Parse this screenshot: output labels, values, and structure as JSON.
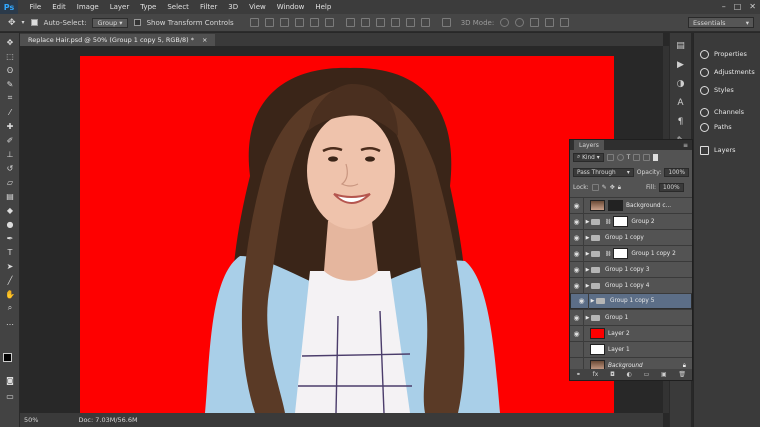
{
  "app": {
    "logo": "Ps"
  },
  "menu": [
    "File",
    "Edit",
    "Image",
    "Layer",
    "Type",
    "Select",
    "Filter",
    "3D",
    "View",
    "Window",
    "Help"
  ],
  "window_controls": [
    "–",
    "□",
    "✕"
  ],
  "options": {
    "auto_select_label": "Auto-Select:",
    "auto_select_value": "Group",
    "show_transform_label": "Show Transform Controls",
    "mode_3d_label": "3D Mode:",
    "workspace": "Essentials"
  },
  "document_tab": {
    "title": "Replace Hair.psd @ 50% (Group 1 copy 5, RGB/8) *",
    "close": "×"
  },
  "status": {
    "zoom": "50%",
    "doc": "Doc: 7.03M/56.6M"
  },
  "right_panel": [
    {
      "label": "Properties",
      "icon": "properties-icon"
    },
    {
      "label": "Adjustments",
      "icon": "adjustments-icon"
    },
    {
      "label": "Styles",
      "icon": "styles-icon"
    },
    {
      "label": "Channels",
      "icon": "channels-icon"
    },
    {
      "label": "Paths",
      "icon": "paths-icon"
    },
    {
      "label": "Layers",
      "icon": "layers-icon"
    }
  ],
  "layers_panel": {
    "tab": "Layers",
    "kind_label": "Kind",
    "blend_mode": "Pass Through",
    "opacity_label": "Opacity:",
    "opacity_value": "100%",
    "lock_label": "Lock:",
    "fill_label": "Fill:",
    "fill_value": "100%",
    "layers": [
      {
        "name": "Background c...",
        "type": "image",
        "visible": true,
        "selected": false,
        "mask": true
      },
      {
        "name": "Group 2",
        "type": "group",
        "visible": true,
        "selected": false,
        "mask": true
      },
      {
        "name": "Group 1 copy",
        "type": "group",
        "visible": true,
        "selected": false,
        "mask": false
      },
      {
        "name": "Group 1 copy 2",
        "type": "group",
        "visible": true,
        "selected": false,
        "mask": true
      },
      {
        "name": "Group 1 copy 3",
        "type": "group",
        "visible": true,
        "selected": false,
        "mask": false
      },
      {
        "name": "Group 1 copy 4",
        "type": "group",
        "visible": true,
        "selected": false,
        "mask": false
      },
      {
        "name": "Group 1 copy 5",
        "type": "group",
        "visible": true,
        "selected": true,
        "mask": false
      },
      {
        "name": "Group 1",
        "type": "group",
        "visible": true,
        "selected": false,
        "mask": false
      },
      {
        "name": "Layer 2",
        "type": "fill",
        "visible": true,
        "selected": false,
        "color": "#fe0000"
      },
      {
        "name": "Layer 1",
        "type": "fill",
        "visible": false,
        "selected": false,
        "color": "#ffffff"
      },
      {
        "name": "Background",
        "type": "image",
        "visible": false,
        "selected": false,
        "locked": true,
        "italic": true
      }
    ]
  },
  "colors": {
    "canvas_background": "#fe0000",
    "selection": "#5c6e87",
    "ui_dark": "#282828"
  }
}
